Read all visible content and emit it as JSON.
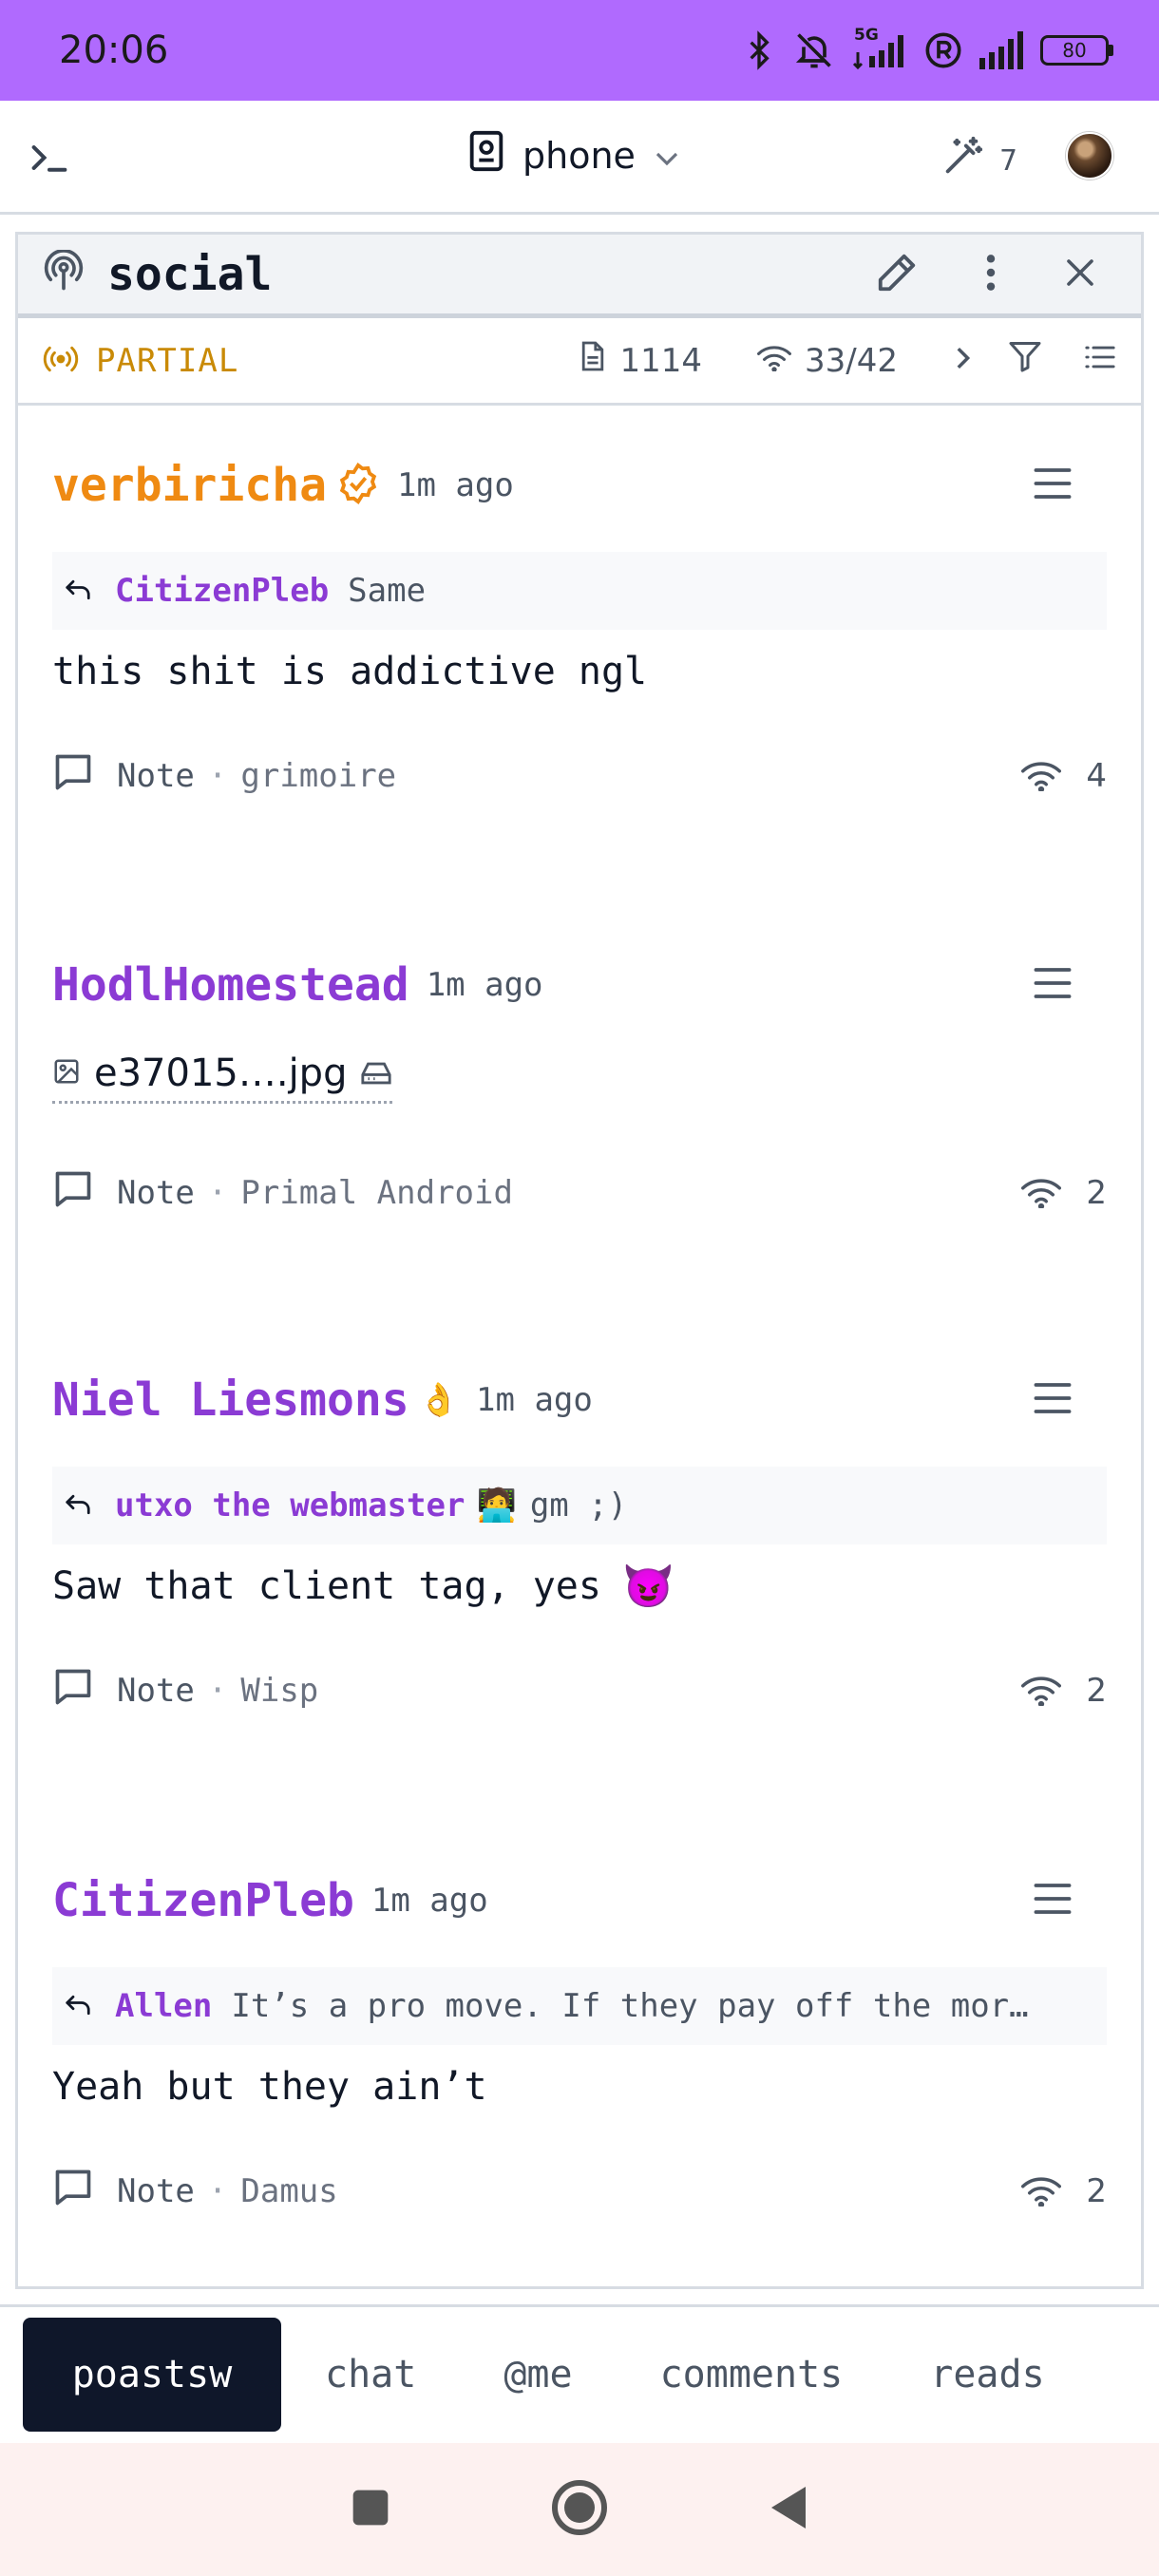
{
  "status_bar": {
    "time": "20:06",
    "network_label": "5G",
    "battery": "80",
    "icons": [
      "bluetooth-icon",
      "bell-off-icon",
      "signal-5g-icon",
      "registered-icon",
      "signal-icon",
      "battery-icon"
    ]
  },
  "top_bar": {
    "device_label": "phone",
    "wand_count": "7",
    "icons": [
      "terminal-icon",
      "device-icon",
      "chevron-down-icon",
      "magic-wand-icon",
      "avatar"
    ]
  },
  "panel": {
    "title": "social",
    "status": "PARTIAL",
    "event_count": "1114",
    "relay_count": "33/42",
    "colors": {
      "status": "#c98a06",
      "author": "#8b3bd4",
      "author_alt": "#ef8a12"
    }
  },
  "posts": [
    {
      "author": "verbiricha",
      "verified": true,
      "time": "1m ago",
      "reply_to": {
        "name": "CitizenPleb",
        "text": "Same"
      },
      "content": "this shit is addictive ngl",
      "kind": "Note",
      "client": "grimoire",
      "relays": "4"
    },
    {
      "author": "HodlHomestead",
      "time": "1m ago",
      "attachment": "e37015….jpg",
      "kind": "Note",
      "client": "Primal Android",
      "relays": "2"
    },
    {
      "author": "Niel Liesmons",
      "author_emoji": "👌",
      "time": "1m ago",
      "reply_to": {
        "name": "utxo the webmaster",
        "emoji": "🧑‍💻",
        "text": "gm ;)"
      },
      "content": "Saw that client tag, yes",
      "content_emoji": "😈",
      "kind": "Note",
      "client": "Wisp",
      "relays": "2"
    },
    {
      "author": "CitizenPleb",
      "time": "1m ago",
      "reply_to": {
        "name": "Allen",
        "text": "It’s a pro move. If they pay off the mor…"
      },
      "content": "Yeah but they ain’t",
      "kind": "Note",
      "client": "Damus",
      "relays": "2"
    }
  ],
  "tabs": [
    {
      "label": "poastsw",
      "active": true
    },
    {
      "label": "chat"
    },
    {
      "label": "@me"
    },
    {
      "label": "comments"
    },
    {
      "label": "reads"
    }
  ],
  "nav_bar": {
    "icons": [
      "recent-apps-icon",
      "home-icon",
      "back-icon"
    ]
  }
}
